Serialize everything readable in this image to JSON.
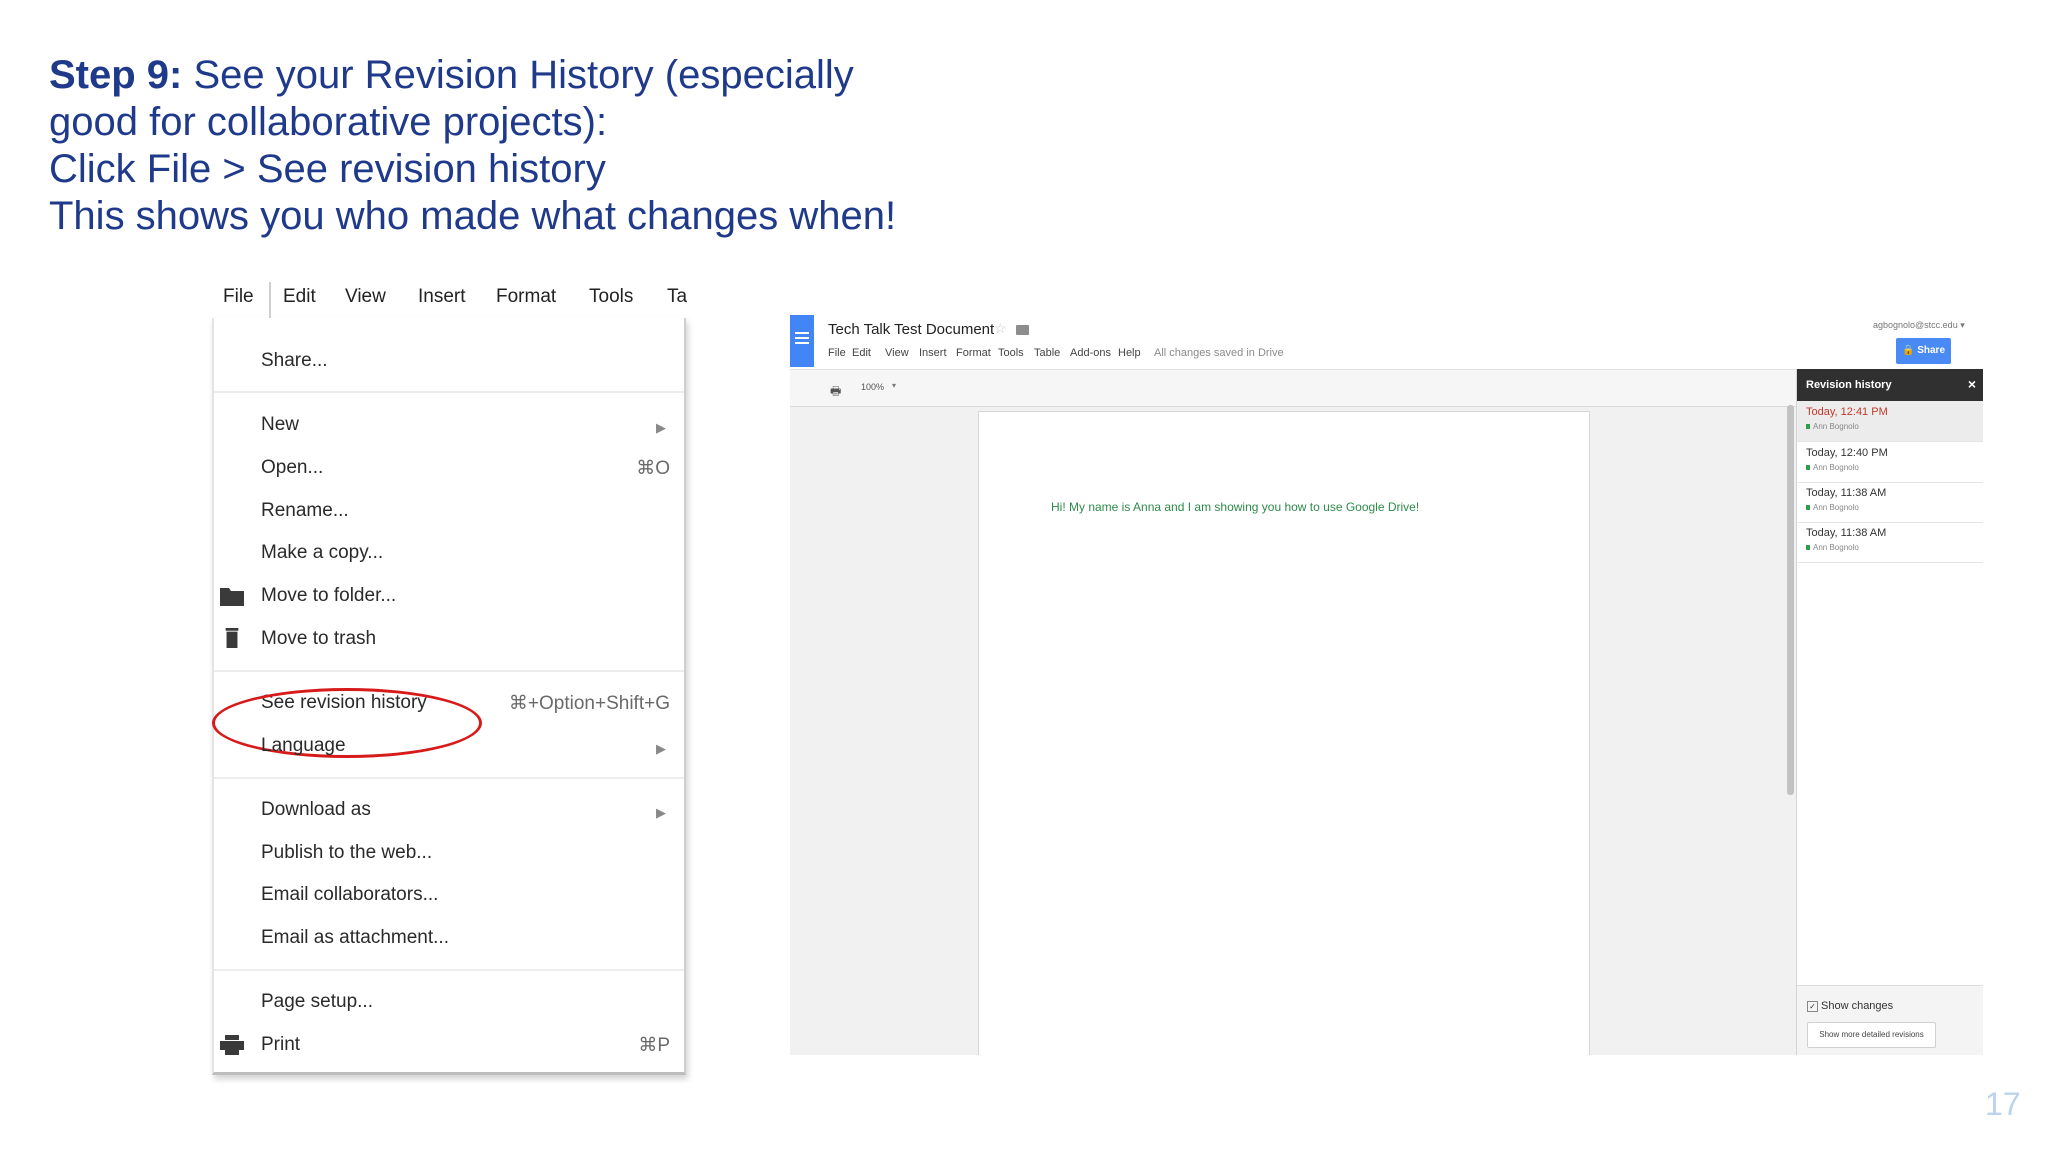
{
  "heading": {
    "step_label": "Step 9:",
    "line1_rest": " See your Revision History (especially",
    "line2": "good for collaborative projects):",
    "line3": "Click File > See revision history",
    "line4": "This shows you who made what changes when!"
  },
  "file_menu": {
    "menubar": [
      "File",
      "Edit",
      "View",
      "Insert",
      "Format",
      "Tools",
      "Ta"
    ],
    "items": {
      "share": "Share...",
      "new": "New",
      "open": "Open...",
      "open_shortcut": "⌘O",
      "rename": "Rename...",
      "make_copy": "Make a copy...",
      "move_to_folder": "Move to folder...",
      "move_to_trash": "Move to trash",
      "see_revision_history": "See revision history",
      "see_revision_history_shortcut": "⌘+Option+Shift+G",
      "language": "Language",
      "download_as": "Download as",
      "publish": "Publish to the web...",
      "email_collaborators": "Email collaborators...",
      "email_attachment": "Email as attachment...",
      "page_setup": "Page setup...",
      "print": "Print",
      "print_shortcut": "⌘P"
    },
    "submenu_arrow": "▶",
    "highlight_color": "#d71a1a"
  },
  "docs": {
    "title": "Tech Talk Test Document",
    "menu": [
      "File",
      "Edit",
      "View",
      "Insert",
      "Format",
      "Tools",
      "Table",
      "Add-ons",
      "Help"
    ],
    "saved_status": "All changes saved in Drive",
    "user_email": "agbognolo@stcc.edu",
    "share_label": "Share",
    "zoom": "100%",
    "body_text": "Hi! My name is Anna and I am showing you how to use Google Drive!",
    "revision_panel": {
      "title": "Revision history",
      "close": "×",
      "revisions": [
        {
          "time": "Today, 12:41 PM",
          "user": "Ann Bognolo"
        },
        {
          "time": "Today, 12:40 PM",
          "user": "Ann Bognolo"
        },
        {
          "time": "Today, 11:38 AM",
          "user": "Ann Bognolo"
        },
        {
          "time": "Today, 11:38 AM",
          "user": "Ann Bognolo"
        }
      ],
      "show_changes": "Show changes",
      "show_more": "Show more detailed revisions"
    },
    "accent_color": "#4285f4"
  },
  "slide_number": "17"
}
